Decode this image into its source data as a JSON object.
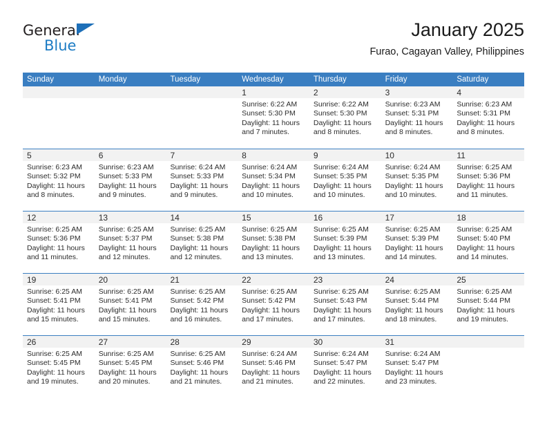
{
  "logo": {
    "word_top": "General",
    "word_bottom": "Blue",
    "triangle_icon": "triangle-icon",
    "color_primary": "#1d7cc4",
    "color_text": "#231f20"
  },
  "header": {
    "title": "January 2025",
    "subtitle": "Furao, Cagayan Valley, Philippines"
  },
  "theme": {
    "header_blue": "#3a7ec1",
    "date_band": "#f2f2f2",
    "text": "#2b2b2b"
  },
  "weekdays": [
    "Sunday",
    "Monday",
    "Tuesday",
    "Wednesday",
    "Thursday",
    "Friday",
    "Saturday"
  ],
  "labels": {
    "sunrise": "Sunrise:",
    "sunset": "Sunset:",
    "daylight": "Daylight:"
  },
  "weeks": [
    [
      {
        "day": "",
        "line1": "",
        "line2": "",
        "line3": "",
        "line4": ""
      },
      {
        "day": "",
        "line1": "",
        "line2": "",
        "line3": "",
        "line4": ""
      },
      {
        "day": "",
        "line1": "",
        "line2": "",
        "line3": "",
        "line4": ""
      },
      {
        "day": "1",
        "line1": "Sunrise: 6:22 AM",
        "line2": "Sunset: 5:30 PM",
        "line3": "Daylight: 11 hours",
        "line4": "and 7 minutes."
      },
      {
        "day": "2",
        "line1": "Sunrise: 6:22 AM",
        "line2": "Sunset: 5:30 PM",
        "line3": "Daylight: 11 hours",
        "line4": "and 8 minutes."
      },
      {
        "day": "3",
        "line1": "Sunrise: 6:23 AM",
        "line2": "Sunset: 5:31 PM",
        "line3": "Daylight: 11 hours",
        "line4": "and 8 minutes."
      },
      {
        "day": "4",
        "line1": "Sunrise: 6:23 AM",
        "line2": "Sunset: 5:31 PM",
        "line3": "Daylight: 11 hours",
        "line4": "and 8 minutes."
      }
    ],
    [
      {
        "day": "5",
        "line1": "Sunrise: 6:23 AM",
        "line2": "Sunset: 5:32 PM",
        "line3": "Daylight: 11 hours",
        "line4": "and 8 minutes."
      },
      {
        "day": "6",
        "line1": "Sunrise: 6:23 AM",
        "line2": "Sunset: 5:33 PM",
        "line3": "Daylight: 11 hours",
        "line4": "and 9 minutes."
      },
      {
        "day": "7",
        "line1": "Sunrise: 6:24 AM",
        "line2": "Sunset: 5:33 PM",
        "line3": "Daylight: 11 hours",
        "line4": "and 9 minutes."
      },
      {
        "day": "8",
        "line1": "Sunrise: 6:24 AM",
        "line2": "Sunset: 5:34 PM",
        "line3": "Daylight: 11 hours",
        "line4": "and 10 minutes."
      },
      {
        "day": "9",
        "line1": "Sunrise: 6:24 AM",
        "line2": "Sunset: 5:35 PM",
        "line3": "Daylight: 11 hours",
        "line4": "and 10 minutes."
      },
      {
        "day": "10",
        "line1": "Sunrise: 6:24 AM",
        "line2": "Sunset: 5:35 PM",
        "line3": "Daylight: 11 hours",
        "line4": "and 10 minutes."
      },
      {
        "day": "11",
        "line1": "Sunrise: 6:25 AM",
        "line2": "Sunset: 5:36 PM",
        "line3": "Daylight: 11 hours",
        "line4": "and 11 minutes."
      }
    ],
    [
      {
        "day": "12",
        "line1": "Sunrise: 6:25 AM",
        "line2": "Sunset: 5:36 PM",
        "line3": "Daylight: 11 hours",
        "line4": "and 11 minutes."
      },
      {
        "day": "13",
        "line1": "Sunrise: 6:25 AM",
        "line2": "Sunset: 5:37 PM",
        "line3": "Daylight: 11 hours",
        "line4": "and 12 minutes."
      },
      {
        "day": "14",
        "line1": "Sunrise: 6:25 AM",
        "line2": "Sunset: 5:38 PM",
        "line3": "Daylight: 11 hours",
        "line4": "and 12 minutes."
      },
      {
        "day": "15",
        "line1": "Sunrise: 6:25 AM",
        "line2": "Sunset: 5:38 PM",
        "line3": "Daylight: 11 hours",
        "line4": "and 13 minutes."
      },
      {
        "day": "16",
        "line1": "Sunrise: 6:25 AM",
        "line2": "Sunset: 5:39 PM",
        "line3": "Daylight: 11 hours",
        "line4": "and 13 minutes."
      },
      {
        "day": "17",
        "line1": "Sunrise: 6:25 AM",
        "line2": "Sunset: 5:39 PM",
        "line3": "Daylight: 11 hours",
        "line4": "and 14 minutes."
      },
      {
        "day": "18",
        "line1": "Sunrise: 6:25 AM",
        "line2": "Sunset: 5:40 PM",
        "line3": "Daylight: 11 hours",
        "line4": "and 14 minutes."
      }
    ],
    [
      {
        "day": "19",
        "line1": "Sunrise: 6:25 AM",
        "line2": "Sunset: 5:41 PM",
        "line3": "Daylight: 11 hours",
        "line4": "and 15 minutes."
      },
      {
        "day": "20",
        "line1": "Sunrise: 6:25 AM",
        "line2": "Sunset: 5:41 PM",
        "line3": "Daylight: 11 hours",
        "line4": "and 15 minutes."
      },
      {
        "day": "21",
        "line1": "Sunrise: 6:25 AM",
        "line2": "Sunset: 5:42 PM",
        "line3": "Daylight: 11 hours",
        "line4": "and 16 minutes."
      },
      {
        "day": "22",
        "line1": "Sunrise: 6:25 AM",
        "line2": "Sunset: 5:42 PM",
        "line3": "Daylight: 11 hours",
        "line4": "and 17 minutes."
      },
      {
        "day": "23",
        "line1": "Sunrise: 6:25 AM",
        "line2": "Sunset: 5:43 PM",
        "line3": "Daylight: 11 hours",
        "line4": "and 17 minutes."
      },
      {
        "day": "24",
        "line1": "Sunrise: 6:25 AM",
        "line2": "Sunset: 5:44 PM",
        "line3": "Daylight: 11 hours",
        "line4": "and 18 minutes."
      },
      {
        "day": "25",
        "line1": "Sunrise: 6:25 AM",
        "line2": "Sunset: 5:44 PM",
        "line3": "Daylight: 11 hours",
        "line4": "and 19 minutes."
      }
    ],
    [
      {
        "day": "26",
        "line1": "Sunrise: 6:25 AM",
        "line2": "Sunset: 5:45 PM",
        "line3": "Daylight: 11 hours",
        "line4": "and 19 minutes."
      },
      {
        "day": "27",
        "line1": "Sunrise: 6:25 AM",
        "line2": "Sunset: 5:45 PM",
        "line3": "Daylight: 11 hours",
        "line4": "and 20 minutes."
      },
      {
        "day": "28",
        "line1": "Sunrise: 6:25 AM",
        "line2": "Sunset: 5:46 PM",
        "line3": "Daylight: 11 hours",
        "line4": "and 21 minutes."
      },
      {
        "day": "29",
        "line1": "Sunrise: 6:24 AM",
        "line2": "Sunset: 5:46 PM",
        "line3": "Daylight: 11 hours",
        "line4": "and 21 minutes."
      },
      {
        "day": "30",
        "line1": "Sunrise: 6:24 AM",
        "line2": "Sunset: 5:47 PM",
        "line3": "Daylight: 11 hours",
        "line4": "and 22 minutes."
      },
      {
        "day": "31",
        "line1": "Sunrise: 6:24 AM",
        "line2": "Sunset: 5:47 PM",
        "line3": "Daylight: 11 hours",
        "line4": "and 23 minutes."
      },
      {
        "day": "",
        "line1": "",
        "line2": "",
        "line3": "",
        "line4": ""
      }
    ]
  ]
}
